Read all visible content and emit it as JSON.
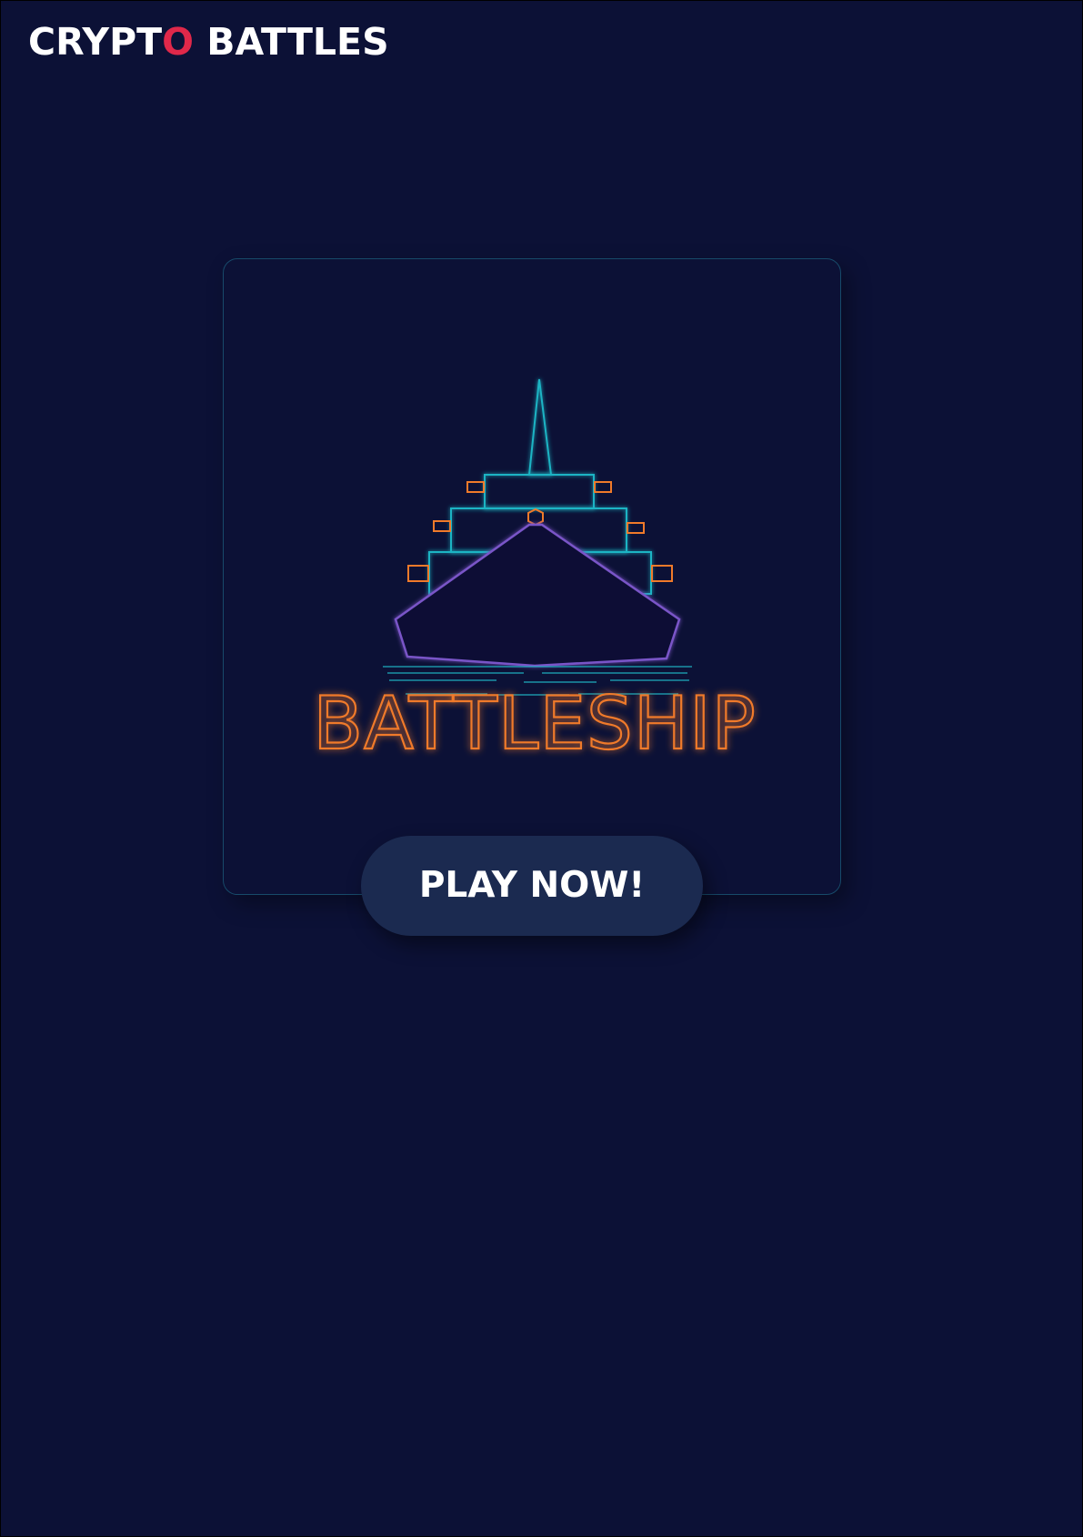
{
  "header": {
    "logo_prefix": "CRYPT",
    "logo_accent": "O",
    "logo_suffix": " BATTLES"
  },
  "game": {
    "title": "BATTLESHIP",
    "play_label": "PLAY NOW!"
  },
  "colors": {
    "background": "#0c1136",
    "logo_accent": "#e0284a",
    "ship_cyan": "#1fb4c4",
    "ship_orange": "#f07a2a",
    "ship_purple": "#7a55c8",
    "button": "#1b2a50"
  },
  "icons": {
    "game_art": "battleship-icon"
  }
}
